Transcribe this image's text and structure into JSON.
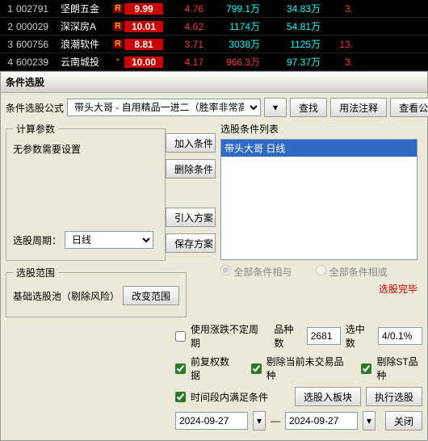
{
  "stocks": [
    {
      "idx": "1",
      "code": "002791",
      "name": "坚朗五金",
      "price": "9.99",
      "chg": "4.76",
      "vol": "799.1万",
      "volColor": "cyan",
      "amt": "34.83万",
      "amtColor": "cyan",
      "last": "3."
    },
    {
      "idx": "2",
      "code": "000029",
      "name": "深深房A",
      "price": "10.01",
      "chg": "4.62",
      "vol": "1174万",
      "volColor": "cyan",
      "amt": "54.81万",
      "amtColor": "cyan",
      "last": ""
    },
    {
      "idx": "3",
      "code": "600756",
      "name": "浪潮软件",
      "price": "8.81",
      "chg": "3.71",
      "vol": "3038万",
      "volColor": "cyan",
      "amt": "1125万",
      "amtColor": "cyan",
      "last": "13."
    },
    {
      "idx": "4",
      "code": "600239",
      "name": "云南城投",
      "price": "10.00",
      "chg": "4.17",
      "vol": "966.3万",
      "volColor": "red",
      "amt": "97.37万",
      "amtColor": "cyan",
      "last": "3."
    }
  ],
  "rMark": "R",
  "starMark": "*",
  "dialog": {
    "title": "条件选股",
    "formulaLabel": "条件选股公式",
    "formulaValue": "带头大哥 - 自用精品一进二（胜率非常高）",
    "btnFind": "查找",
    "btnUsage": "用法注释",
    "btnView": "查看公式",
    "calcLegend": "计算参数",
    "noParams": "无参数需要设置",
    "periodLabel": "选股周期：",
    "periodValue": "日线",
    "rangeLegend": "选股范围",
    "rangePool": "基础选股池（剔除风险）",
    "btnChangeRange": "改变范围",
    "btnAddCond": "加入条件",
    "btnDelCond": "删除条件",
    "btnImport": "引入方案",
    "btnSave": "保存方案",
    "listLegend": "选股条件列表",
    "listItem": "带头大哥  日线",
    "radioAnd": "全部条件相与",
    "radioOr": "全部条件相或",
    "status": "选股完毕",
    "chkVarPeriod": "使用涨跌不定周期",
    "countLabel": "品种数",
    "countVal": "2681",
    "selLabel": "选中数",
    "selVal": "4/0.1%",
    "chkFQ": "前复权数据",
    "chkExclNoTrade": "剔除当前未交易品种",
    "chkExclST": "剔除ST品种",
    "chkTimeRange": "时间段内满足条件",
    "btnToBlock": "选股入板块",
    "btnExec": "执行选股",
    "date1": "2024-09-27",
    "date2": "2024-09-27",
    "dash": "—",
    "btnClose": "关闭"
  }
}
